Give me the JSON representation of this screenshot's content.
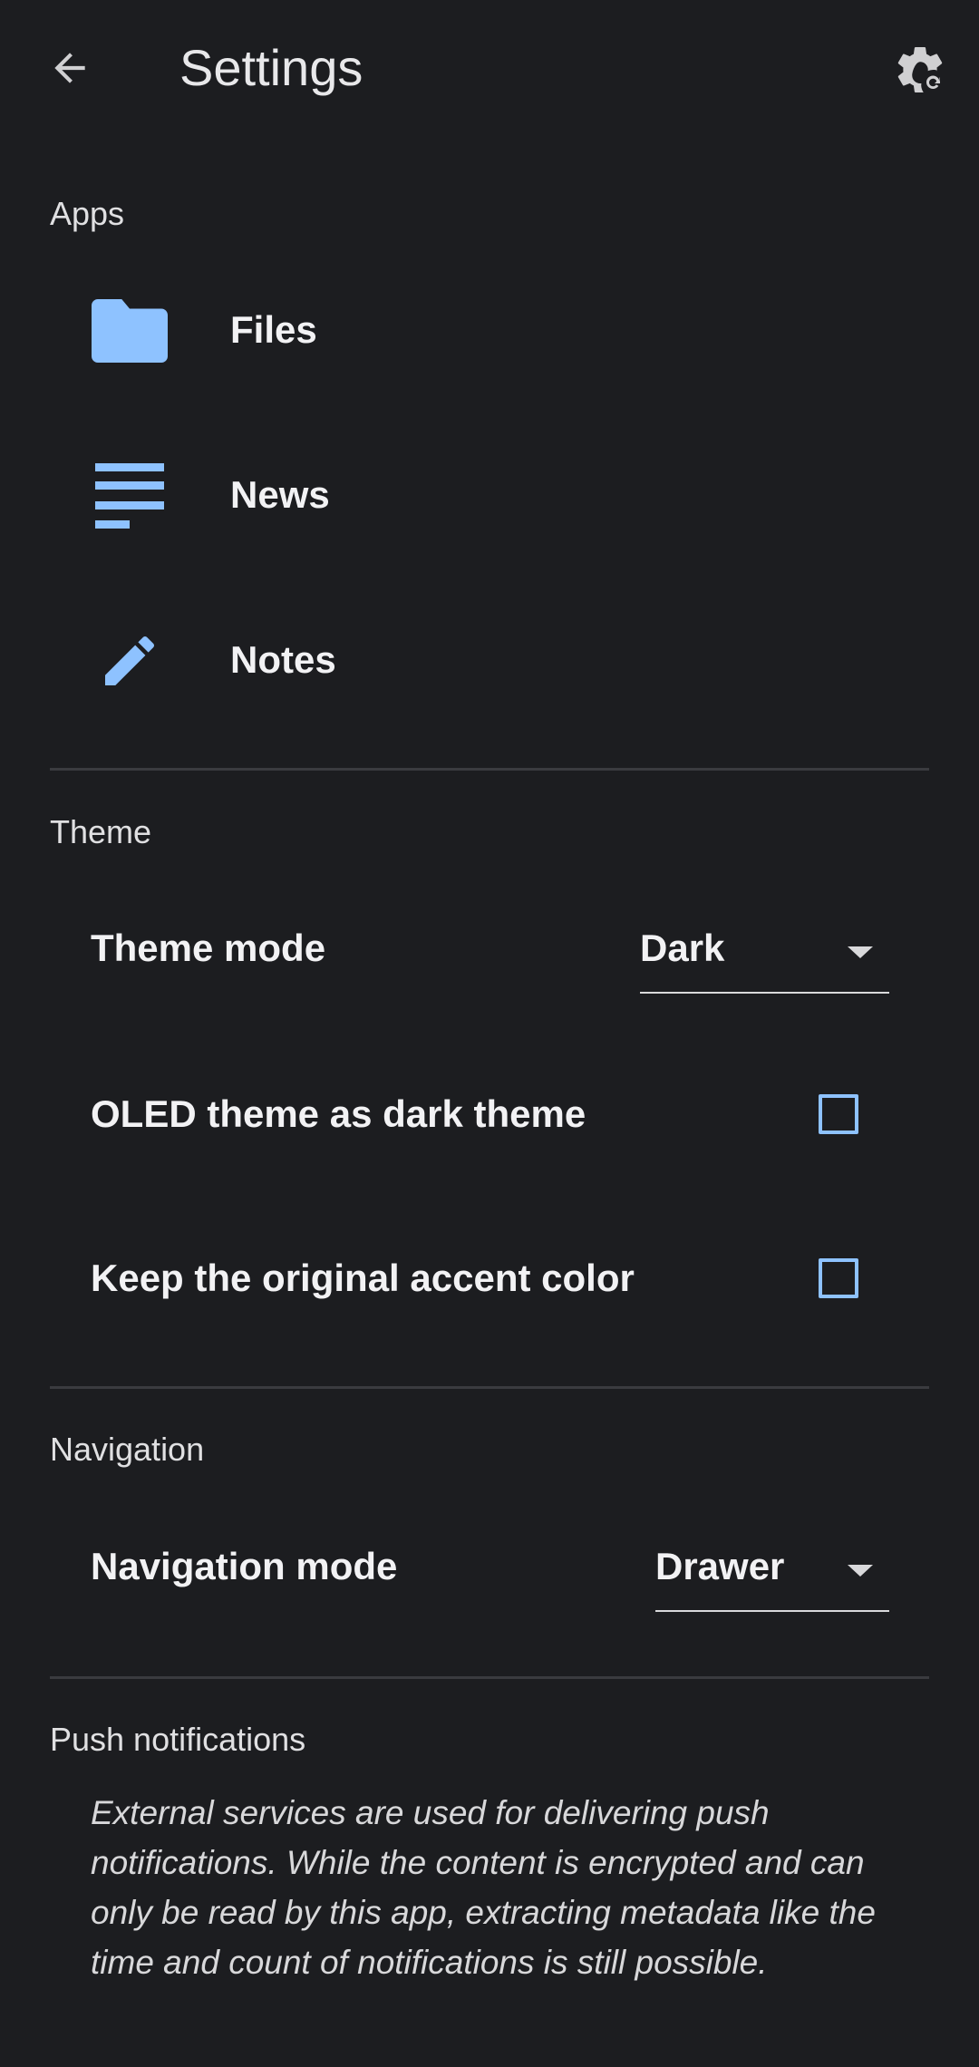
{
  "appbar": {
    "title": "Settings",
    "back_icon": "arrow-back-icon",
    "reset_icon": "settings-reset-icon"
  },
  "sections": {
    "apps": {
      "header": "Apps",
      "items": [
        {
          "label": "Files",
          "icon": "folder-icon"
        },
        {
          "label": "News",
          "icon": "news-lines-icon"
        },
        {
          "label": "Notes",
          "icon": "pencil-icon"
        }
      ]
    },
    "theme": {
      "header": "Theme",
      "theme_mode": {
        "label": "Theme mode",
        "value": "Dark"
      },
      "oled": {
        "label": "OLED theme as dark theme",
        "checked": false
      },
      "accent": {
        "label": "Keep the original accent color",
        "checked": false
      }
    },
    "navigation": {
      "header": "Navigation",
      "mode": {
        "label": "Navigation mode",
        "value": "Drawer"
      }
    },
    "push": {
      "header": "Push notifications",
      "description": "External services are used for delivering push notifications. While the content is encrypted and can only be read by this app, extracting metadata like the time and count of notifications is still possible."
    }
  },
  "colors": {
    "background": "#1c1d20",
    "accent": "#8ec2ff",
    "divider": "#3a3b3f"
  }
}
